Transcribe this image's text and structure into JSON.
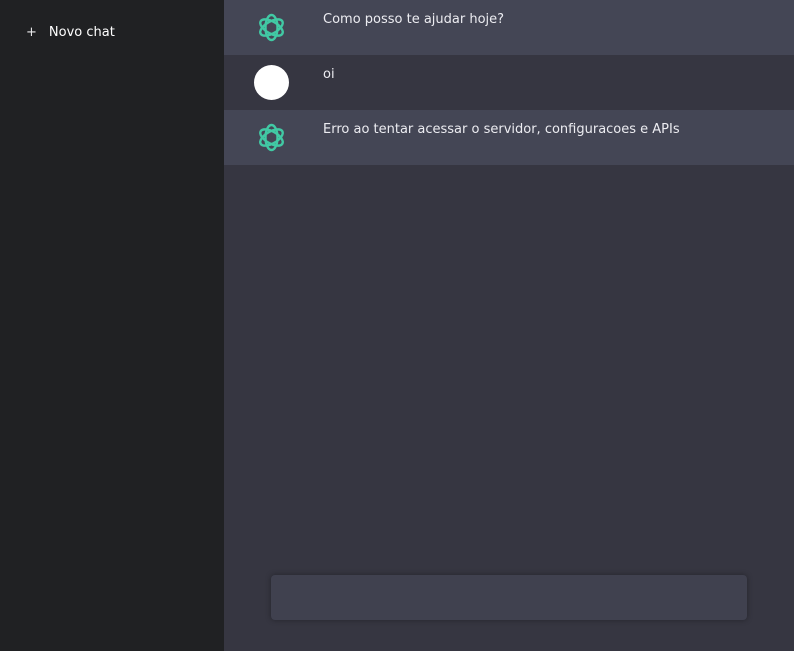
{
  "sidebar": {
    "new_chat_icon": "+",
    "new_chat_label": "Novo chat"
  },
  "messages": [
    {
      "role": "bot",
      "avatar": "openai-logo-icon",
      "text": "Como posso te ajudar hoje?"
    },
    {
      "role": "user",
      "avatar": "user-avatar",
      "text": "oi"
    },
    {
      "role": "bot",
      "avatar": "openai-logo-icon",
      "text": "Erro ao tentar acessar o servidor, configuracoes e APIs"
    }
  ],
  "composer": {
    "value": "",
    "placeholder": ""
  },
  "colors": {
    "sidebar_bg": "#202123",
    "main_bg": "#363641",
    "bot_row_bg": "#444655",
    "logo_accent": "#41c9a4"
  }
}
